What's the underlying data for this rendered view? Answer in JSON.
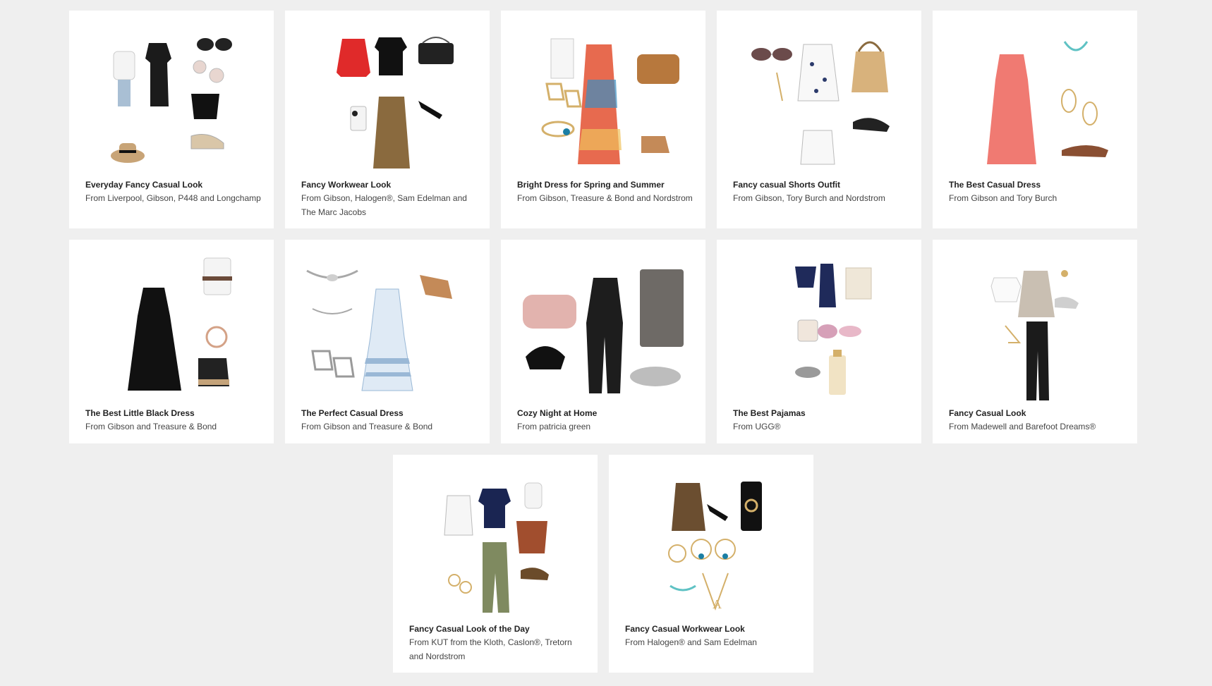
{
  "looks": [
    {
      "title": "Everyday Fancy Casual Look",
      "subtitle": "From Liverpool, Gibson, P448 and Longchamp",
      "icon": "outfit-collage-icon"
    },
    {
      "title": "Fancy Workwear Look",
      "subtitle": "From Gibson, Halogen®, Sam Edelman and The Marc Jacobs",
      "icon": "outfit-collage-icon"
    },
    {
      "title": "Bright Dress for Spring and Summer",
      "subtitle": "From Gibson, Treasure & Bond and Nordstrom",
      "icon": "outfit-collage-icon"
    },
    {
      "title": "Fancy casual Shorts Outfit",
      "subtitle": "From Gibson, Tory Burch and Nordstrom",
      "icon": "outfit-collage-icon"
    },
    {
      "title": "The Best Casual Dress",
      "subtitle": "From Gibson and Tory Burch",
      "icon": "outfit-collage-icon"
    },
    {
      "title": "The Best Little Black Dress",
      "subtitle": "From Gibson and Treasure & Bond",
      "icon": "outfit-collage-icon"
    },
    {
      "title": "The Perfect Casual Dress",
      "subtitle": "From Gibson and Treasure & Bond",
      "icon": "outfit-collage-icon"
    },
    {
      "title": "Cozy Night at Home",
      "subtitle": "From patricia green",
      "icon": "outfit-collage-icon"
    },
    {
      "title": "The Best Pajamas",
      "subtitle": "From UGG®",
      "icon": "outfit-collage-icon"
    },
    {
      "title": "Fancy Casual Look",
      "subtitle": "From Madewell and Barefoot Dreams®",
      "icon": "outfit-collage-icon"
    },
    {
      "title": "Fancy Casual Look of the Day",
      "subtitle": "From KUT from the Kloth, Caslon®, Tretorn and Nordstrom",
      "icon": "outfit-collage-icon"
    },
    {
      "title": "Fancy Casual Workwear Look",
      "subtitle": "From Halogen® and Sam Edelman",
      "icon": "outfit-collage-icon"
    }
  ],
  "colors": {
    "page_background": "#efefef",
    "card_background": "#ffffff",
    "title_text": "#222222",
    "subtitle_text": "#444444"
  }
}
